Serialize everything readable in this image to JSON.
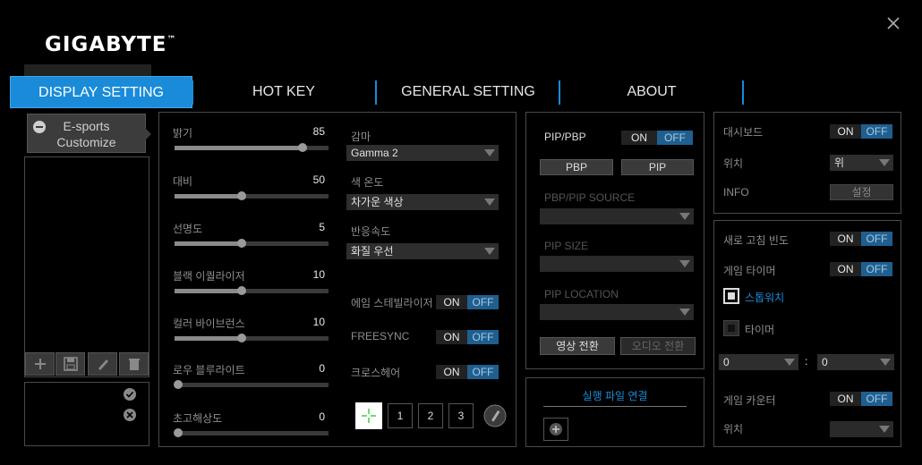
{
  "header": {
    "brand": "GIGABYTE",
    "trademark": "™"
  },
  "tabs": [
    {
      "label": "DISPLAY SETTING"
    },
    {
      "label": "HOT KEY"
    },
    {
      "label": "GENERAL SETTING"
    },
    {
      "label": "ABOUT"
    }
  ],
  "profile": {
    "line1": "E-sports",
    "line2": "Customize"
  },
  "sliders": [
    {
      "label": "밝기",
      "value": "85",
      "fraction": 0.98
    },
    {
      "label": "대비",
      "value": "50",
      "fraction": 0.5
    },
    {
      "label": "선명도",
      "value": "5",
      "fraction": 0.5
    },
    {
      "label": "블랙 이퀄라이저",
      "value": "10",
      "fraction": 0.5
    },
    {
      "label": "컬러 바이브런스",
      "value": "10",
      "fraction": 0.5
    },
    {
      "label": "로우 블루라이트",
      "value": "0",
      "fraction": 0.0
    },
    {
      "label": "초고해상도",
      "value": "0",
      "fraction": 0.0
    }
  ],
  "selects": [
    {
      "label": "감마",
      "value": "Gamma 2"
    },
    {
      "label": "색 온도",
      "value": "차가운 색상"
    },
    {
      "label": "반응속도",
      "value": "화질 우선"
    }
  ],
  "toggles_mid": [
    {
      "label": "에임 스테빌라이저"
    },
    {
      "label": "FREESYNC"
    },
    {
      "label": "크로스헤어"
    }
  ],
  "crosshair_nums": [
    "1",
    "2",
    "3"
  ],
  "toggle_text": {
    "on": "ON",
    "off": "OFF"
  },
  "pip": {
    "title": "PIP/PBP",
    "pbp_button": "PBP",
    "pip_button": "PIP",
    "source_label": "PBP/PIP SOURCE",
    "size_label": "PIP SIZE",
    "location_label": "PIP LOCATION",
    "video_switch": "영상 전환",
    "audio_switch": "오디오 전환"
  },
  "app_link": {
    "label": "실행 파일 연결"
  },
  "dashboard": {
    "title": "대시보드",
    "position_label": "위치",
    "position_value": "위",
    "info_label": "INFO",
    "settings_button": "설정"
  },
  "game": {
    "refresh_label": "새로 고침 빈도",
    "timer_label": "게임 타이머",
    "stopwatch_label": "스톱워치",
    "timer_item_label": "타이머",
    "min_value": "0",
    "colon": ":",
    "sec_value": "0",
    "counter_label": "게임 카운터",
    "counter_position_label": "위치"
  },
  "colors": {
    "accent": "#1a8bd9",
    "toggle_off": "#1f5f8f"
  }
}
